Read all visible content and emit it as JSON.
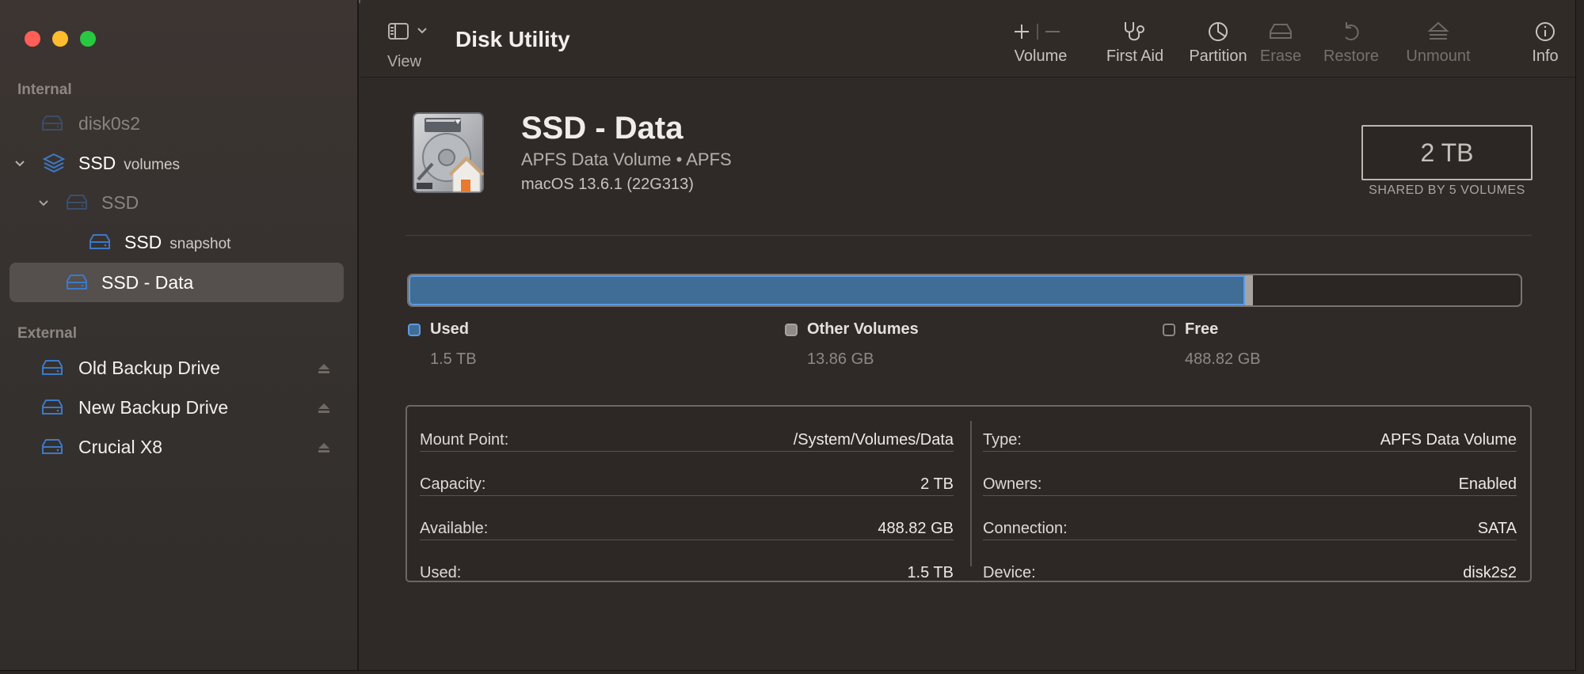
{
  "app": {
    "title": "Disk Utility"
  },
  "toolbar": {
    "view_label": "View",
    "items": [
      {
        "label": "Volume",
        "icon": "volume-add-remove-icon",
        "enabled": true
      },
      {
        "label": "First Aid",
        "icon": "stethoscope-icon",
        "enabled": true
      },
      {
        "label": "Partition",
        "icon": "pie-chart-icon",
        "enabled": true
      },
      {
        "label": "Erase",
        "icon": "erase-icon",
        "enabled": false
      },
      {
        "label": "Restore",
        "icon": "restore-icon",
        "enabled": false
      },
      {
        "label": "Unmount",
        "icon": "eject-icon",
        "enabled": false
      },
      {
        "label": "Info",
        "icon": "info-icon",
        "enabled": true
      }
    ]
  },
  "sidebar": {
    "sections": [
      {
        "label": "Internal"
      },
      {
        "label": "External"
      }
    ],
    "internal_items": [
      {
        "label": "disk0s2",
        "suffix": "",
        "icon": "drive-icon"
      },
      {
        "label": "SSD",
        "suffix": "volumes",
        "icon": "layers-icon"
      },
      {
        "label": "SSD",
        "suffix": "",
        "icon": "drive-icon"
      },
      {
        "label": "SSD",
        "suffix": "snapshot",
        "icon": "drive-icon"
      },
      {
        "label": "SSD - Data",
        "suffix": "",
        "icon": "drive-icon"
      }
    ],
    "external_items": [
      {
        "label": "Old Backup Drive",
        "icon": "drive-icon"
      },
      {
        "label": "New Backup Drive",
        "icon": "drive-icon"
      },
      {
        "label": "Crucial X8",
        "icon": "drive-icon"
      }
    ]
  },
  "volume": {
    "name": "SSD - Data",
    "type_line": "APFS Data Volume • APFS",
    "os_line": "macOS 13.6.1 (22G313)",
    "capacity_badge": "2 TB",
    "capacity_caption": "SHARED BY 5 VOLUMES"
  },
  "usage": {
    "used_fraction": 0.752,
    "other_fraction": 0.007,
    "legend": [
      {
        "name": "Used",
        "value": "1.5 TB",
        "color": "#3f6d96"
      },
      {
        "name": "Other Volumes",
        "value": "13.86 GB",
        "color": "#a7a3a0"
      },
      {
        "name": "Free",
        "value": "488.82 GB",
        "color": "#2b2624"
      }
    ]
  },
  "details": {
    "left": [
      {
        "key": "Mount Point:",
        "value": "/System/Volumes/Data"
      },
      {
        "key": "Capacity:",
        "value": "2 TB"
      },
      {
        "key": "Available:",
        "value": "488.82 GB"
      },
      {
        "key": "Used:",
        "value": "1.5 TB"
      }
    ],
    "right": [
      {
        "key": "Type:",
        "value": "APFS Data Volume"
      },
      {
        "key": "Owners:",
        "value": "Enabled"
      },
      {
        "key": "Connection:",
        "value": "SATA"
      },
      {
        "key": "Device:",
        "value": "disk2s2"
      }
    ]
  },
  "colors": {
    "accent": "#3d79c8",
    "used_bar": "#3f6d96",
    "other_bar": "#a7a3a0"
  }
}
